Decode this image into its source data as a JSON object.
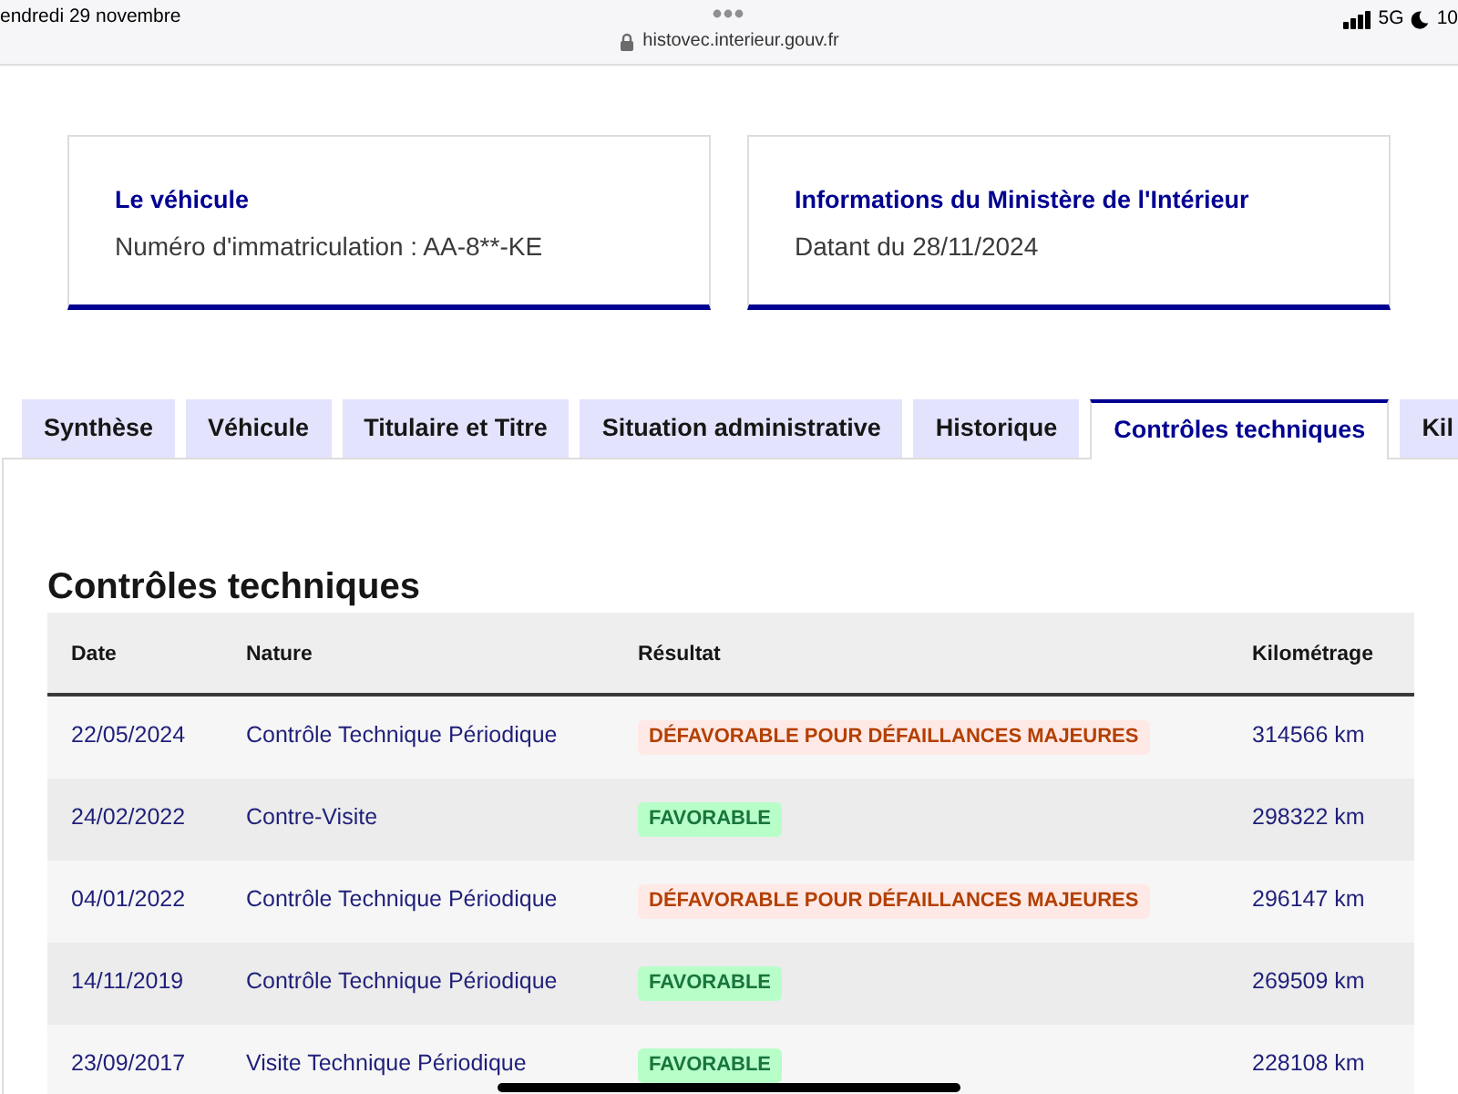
{
  "status_bar": {
    "date": "endredi 29 novembre",
    "url": "histovec.interieur.gouv.fr",
    "network": "5G",
    "battery": "10"
  },
  "cards": [
    {
      "title": "Le véhicule",
      "text": "Numéro d'immatriculation : AA-8**-KE"
    },
    {
      "title": "Informations du Ministère de l'Intérieur",
      "text": "Datant du 28/11/2024"
    }
  ],
  "tabs": [
    {
      "label": "Synthèse",
      "selected": false
    },
    {
      "label": "Véhicule",
      "selected": false
    },
    {
      "label": "Titulaire et Titre",
      "selected": false
    },
    {
      "label": "Situation administrative",
      "selected": false
    },
    {
      "label": "Historique",
      "selected": false
    },
    {
      "label": "Contrôles techniques",
      "selected": true
    },
    {
      "label": "Kil",
      "selected": false
    }
  ],
  "section": {
    "title": "Contrôles techniques"
  },
  "table": {
    "columns": [
      "Date",
      "Nature",
      "Résultat",
      "Kilométrage"
    ],
    "rows": [
      {
        "date": "22/05/2024",
        "nature": "Contrôle Technique Périodique",
        "result": {
          "label": "DÉFAVORABLE POUR DÉFAILLANCES MAJEURES",
          "kind": "error"
        },
        "mileage": "314566 km"
      },
      {
        "date": "24/02/2022",
        "nature": "Contre-Visite",
        "result": {
          "label": "FAVORABLE",
          "kind": "success"
        },
        "mileage": "298322 km"
      },
      {
        "date": "04/01/2022",
        "nature": "Contrôle Technique Périodique",
        "result": {
          "label": "DÉFAVORABLE POUR DÉFAILLANCES MAJEURES",
          "kind": "error"
        },
        "mileage": "296147 km"
      },
      {
        "date": "14/11/2019",
        "nature": "Contrôle Technique Périodique",
        "result": {
          "label": "FAVORABLE",
          "kind": "success"
        },
        "mileage": "269509 km"
      },
      {
        "date": "23/09/2017",
        "nature": "Visite Technique Périodique",
        "result": {
          "label": "FAVORABLE",
          "kind": "success"
        },
        "mileage": "228108 km"
      }
    ]
  }
}
